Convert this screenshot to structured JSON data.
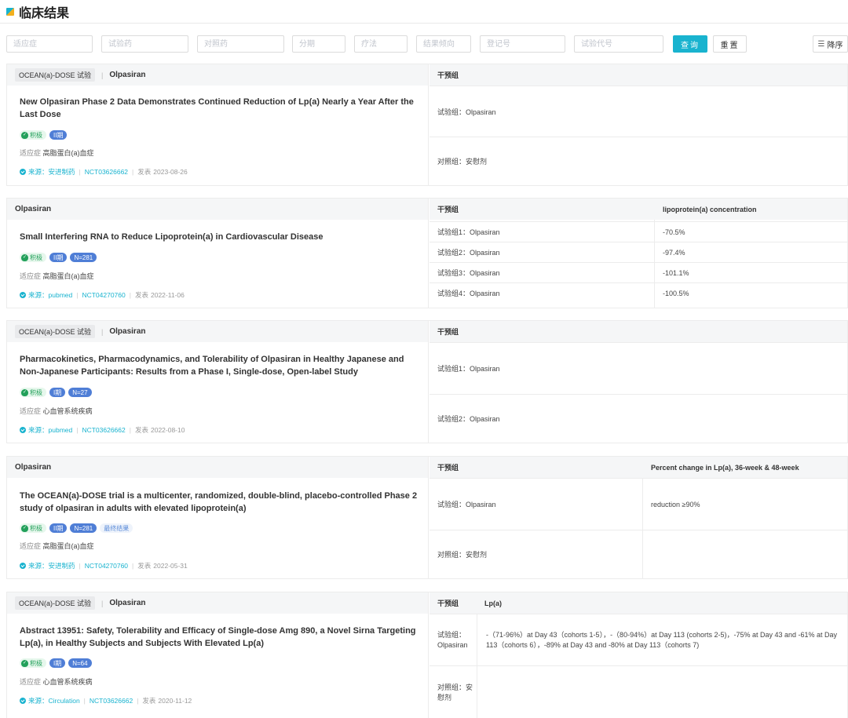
{
  "page": {
    "title": "临床结果"
  },
  "filters": {
    "indication": "适应症",
    "trial_drug": "试验药",
    "control_drug": "对照药",
    "phase": "分期",
    "therapy": "疗法",
    "result_tendency": "结果倾向",
    "registry_no": "登记号",
    "trial_code": "试验代号",
    "query_label": "查询",
    "reset_label": "重置",
    "sort_label": "降序",
    "sort_icon": "sort-descending-icon"
  },
  "cards": [
    {
      "trial": "OCEAN(a)-DOSE 试验",
      "drug": "Olpasiran",
      "title": "New Olpasiran Phase 2 Data Demonstrates Continued Reduction of Lp(a) Nearly a Year After the Last Dose",
      "badges": {
        "positive": "积极",
        "phase": "II期"
      },
      "indication_label": "适应症",
      "indication": "高脂蛋白(a)血症",
      "source_label": "来源：",
      "source": "安进制药",
      "nct": "NCT03626662",
      "date_label": "发表",
      "date": "2023-08-26",
      "table": {
        "headers": [
          "干预组"
        ],
        "rows": [
          [
            "试验组：Olpasiran"
          ],
          [
            "对照组：安慰剂"
          ]
        ]
      }
    },
    {
      "drug": "Olpasiran",
      "title": "Small Interfering RNA to Reduce Lipoprotein(a) in Cardiovascular Disease",
      "badges": {
        "positive": "积极",
        "phase": "II期",
        "n": "N=281"
      },
      "indication_label": "适应症",
      "indication": "高脂蛋白(a)血症",
      "source_label": "来源：",
      "source": "pubmed",
      "nct": "NCT04270760",
      "date_label": "发表",
      "date": "2022-11-06",
      "table": {
        "headers": [
          "干预组",
          "lipoprotein(a) concentration"
        ],
        "rows": [
          [
            "试验组1：Olpasiran",
            "-70.5%"
          ],
          [
            "试验组2：Olpasiran",
            "-97.4%"
          ],
          [
            "试验组3：Olpasiran",
            "-101.1%"
          ],
          [
            "试验组4：Olpasiran",
            "-100.5%"
          ]
        ]
      }
    },
    {
      "trial": "OCEAN(a)-DOSE 试验",
      "drug": "Olpasiran",
      "title": "Pharmacokinetics, Pharmacodynamics, and Tolerability of Olpasiran in Healthy Japanese and Non-Japanese Participants: Results from a Phase I, Single-dose, Open-label Study",
      "badges": {
        "positive": "积极",
        "phase": "I期",
        "n": "N=27"
      },
      "indication_label": "适应症",
      "indication": "心血管系统疾病",
      "source_label": "来源：",
      "source": "pubmed",
      "nct": "NCT03626662",
      "date_label": "发表",
      "date": "2022-08-10",
      "table": {
        "headers": [
          "干预组"
        ],
        "rows": [
          [
            "试验组1：Olpasiran"
          ],
          [
            "试验组2：Olpasiran"
          ]
        ]
      }
    },
    {
      "drug": "Olpasiran",
      "title": "The OCEAN(a)-DOSE trial is a multicenter, randomized, double-blind, placebo-controlled Phase 2 study of olpasiran in adults with elevated lipoprotein(a)",
      "badges": {
        "positive": "积极",
        "phase": "II期",
        "n": "N=281",
        "final": "最终结果"
      },
      "indication_label": "适应症",
      "indication": "高脂蛋白(a)血症",
      "source_label": "来源：",
      "source": "安进制药",
      "nct": "NCT04270760",
      "date_label": "发表",
      "date": "2022-05-31",
      "table": {
        "headers": [
          "干预组",
          "Percent change in Lp(a), 36-week & 48-week"
        ],
        "rows": [
          [
            "试验组：Olpasiran",
            "reduction ≥90%"
          ],
          [
            "对照组：安慰剂",
            ""
          ]
        ]
      }
    },
    {
      "trial": "OCEAN(a)-DOSE 试验",
      "drug": "Olpasiran",
      "title": "Abstract 13951: Safety, Tolerability and Efficacy of Single-dose Amg 890, a Novel Sirna Targeting Lp(a), in Healthy Subjects and Subjects With Elevated Lp(a)",
      "badges": {
        "positive": "积极",
        "phase": "I期",
        "n": "N=64"
      },
      "indication_label": "适应症",
      "indication": "心血管系统疾病",
      "source_label": "来源：",
      "source": "Circulation",
      "nct": "NCT03626662",
      "date_label": "发表",
      "date": "2020-11-12",
      "table": {
        "headers": [
          "干预组",
          "Lp(a)"
        ],
        "rows": [
          [
            "试验组：Olpasiran",
            "-（71-96%）at Day 43（cohorts 1-5），-（80-94%）at Day 113 (cohorts 2-5)，-75% at Day 43 and -61% at Day 113（cohorts 6），-89% at Day 43 and -80% at Day 113（cohorts 7)"
          ],
          [
            "对照组：安慰剂",
            ""
          ]
        ]
      }
    }
  ]
}
